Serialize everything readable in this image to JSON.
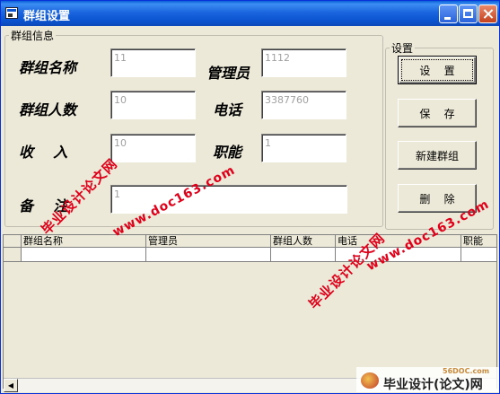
{
  "window": {
    "title": "群组设置"
  },
  "groups": {
    "info_legend": "群组信息",
    "settings_legend": "设置"
  },
  "fields": {
    "group_name": {
      "label": "群组名称",
      "value": "11"
    },
    "manager": {
      "label": "管理员",
      "value": "1112"
    },
    "member_count": {
      "label": "群组人数",
      "value": "10"
    },
    "phone": {
      "label": "电话",
      "value": "3387760"
    },
    "income": {
      "label": "收    入",
      "value": "10"
    },
    "duty": {
      "label": "职能",
      "value": "1"
    },
    "remark": {
      "label": "备    注",
      "value": "1"
    }
  },
  "buttons": {
    "settings": "设    置",
    "save": "保    存",
    "new_group": "新建群组",
    "delete": "删    除"
  },
  "table": {
    "columns": [
      "",
      "群组名称",
      "管理员",
      "群组人数",
      "电话",
      "职能"
    ]
  },
  "watermarks": {
    "cn": "毕业设计论文网",
    "url": "www.doc163.com"
  },
  "footer": {
    "site": "56DOC.com",
    "brand": "毕业设计(论文)网"
  },
  "colors": {
    "title_bar": "#0b53cf",
    "watermark": "#e0001a",
    "window_bg": "#ece9d8"
  }
}
